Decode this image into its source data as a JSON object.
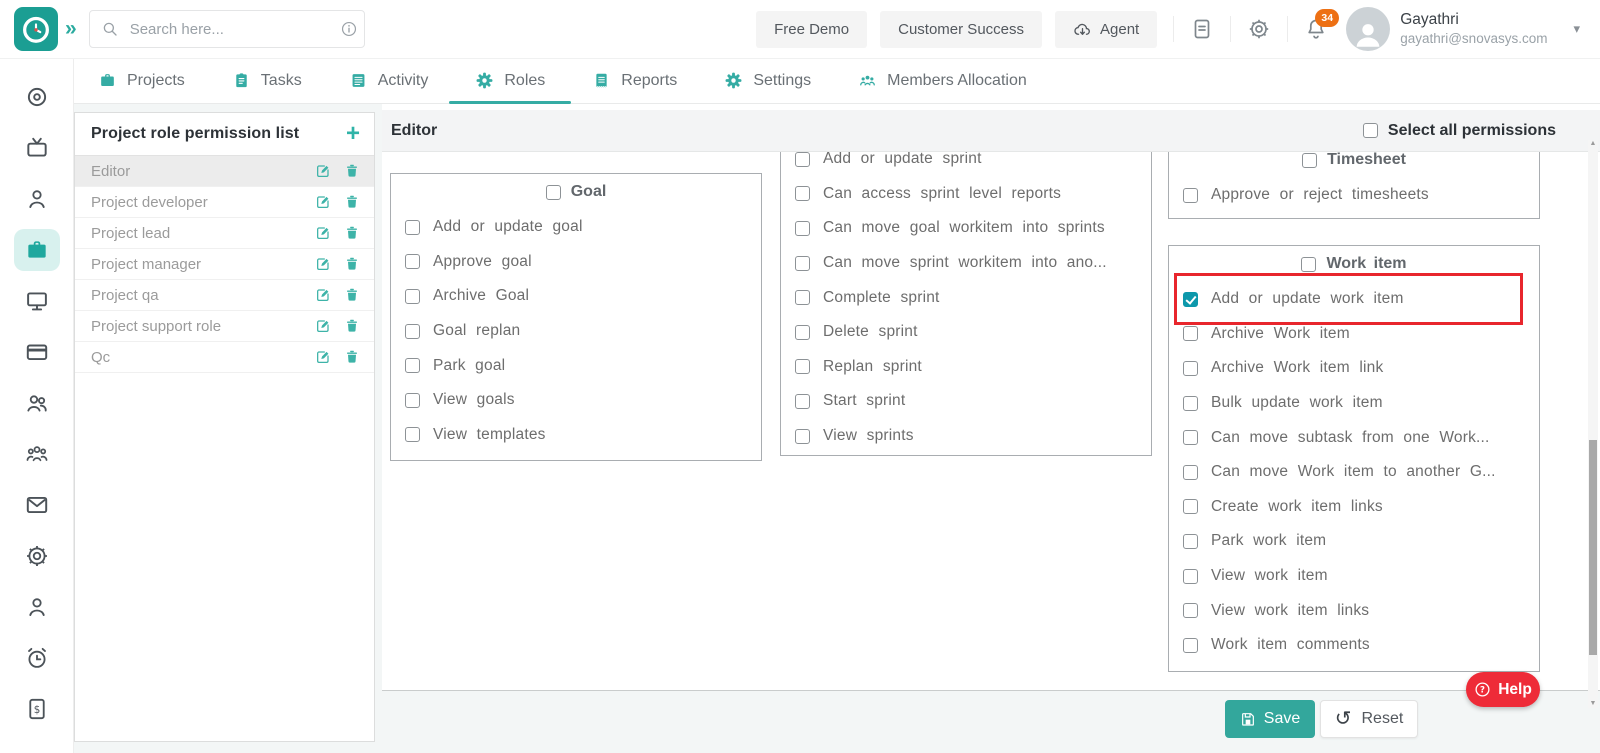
{
  "topbar": {
    "search_placeholder": "Search here...",
    "free_demo_label": "Free Demo",
    "customer_success_label": "Customer Success",
    "agent_label": "Agent",
    "notification_count": "34",
    "user_name": "Gayathri",
    "user_email": "gayathri@snovasys.com"
  },
  "tabs": [
    {
      "label": "Projects",
      "icon": "briefcase-icon",
      "active": false
    },
    {
      "label": "Tasks",
      "icon": "clipboard-icon",
      "active": false
    },
    {
      "label": "Activity",
      "icon": "activity-list-icon",
      "active": false
    },
    {
      "label": "Roles",
      "icon": "roles-gear-icon",
      "active": true
    },
    {
      "label": "Reports",
      "icon": "report-icon",
      "active": false
    },
    {
      "label": "Settings",
      "icon": "settings-gear-icon",
      "active": false
    },
    {
      "label": "Members Allocation",
      "icon": "members-group-icon",
      "active": false
    }
  ],
  "sidebar": {
    "active_index": 3,
    "icons": [
      "target-icon",
      "tv-icon",
      "person-icon",
      "briefcase-icon",
      "monitor-icon",
      "credit-card-icon",
      "users-pair-icon",
      "team-icon",
      "mail-icon",
      "gear-icon",
      "person-outline-icon",
      "alarm-clock-icon",
      "invoice-icon"
    ]
  },
  "role_panel": {
    "title": "Project role permission list",
    "add_label": "+",
    "roles": [
      {
        "label": "Editor",
        "selected": true
      },
      {
        "label": "Project developer",
        "selected": false
      },
      {
        "label": "Project lead",
        "selected": false
      },
      {
        "label": "Project manager",
        "selected": false
      },
      {
        "label": "Project qa",
        "selected": false
      },
      {
        "label": "Project support role",
        "selected": false
      },
      {
        "label": "Qc",
        "selected": false
      }
    ]
  },
  "permissions_header": {
    "role_title": "Editor",
    "select_all_label": "Select all permissions",
    "select_all_checked": false
  },
  "permission_groups": [
    {
      "id": "goal",
      "title": "Goal",
      "title_visible": true,
      "group_checked": false,
      "items": [
        {
          "label": "Add or update goal",
          "checked": false
        },
        {
          "label": "Approve goal",
          "checked": false
        },
        {
          "label": "Archive Goal",
          "checked": false
        },
        {
          "label": "Goal replan",
          "checked": false
        },
        {
          "label": "Park goal",
          "checked": false
        },
        {
          "label": "View goals",
          "checked": false
        },
        {
          "label": "View templates",
          "checked": false
        }
      ]
    },
    {
      "id": "sprint",
      "title": "",
      "title_visible": false,
      "items": [
        {
          "label": "Add or update sprint",
          "checked": false
        },
        {
          "label": "Can access sprint level reports",
          "checked": false
        },
        {
          "label": "Can move goal workitem into sprints",
          "checked": false
        },
        {
          "label": "Can move sprint workitem into ano...",
          "checked": false
        },
        {
          "label": "Complete sprint",
          "checked": false
        },
        {
          "label": "Delete sprint",
          "checked": false
        },
        {
          "label": "Replan sprint",
          "checked": false
        },
        {
          "label": "Start sprint",
          "checked": false
        },
        {
          "label": "View sprints",
          "checked": false
        }
      ]
    },
    {
      "id": "timesheet",
      "title": "Timesheet",
      "title_visible": true,
      "group_checked": false,
      "items": [
        {
          "label": "Approve or reject timesheets",
          "checked": false
        }
      ]
    },
    {
      "id": "workitem",
      "title": "Work item",
      "title_visible": true,
      "group_checked": false,
      "items": [
        {
          "label": "Add or update work item",
          "checked": true,
          "highlighted": true
        },
        {
          "label": "Archive Work item",
          "checked": false
        },
        {
          "label": "Archive Work item link",
          "checked": false
        },
        {
          "label": "Bulk update work item",
          "checked": false
        },
        {
          "label": "Can move subtask from one Work...",
          "checked": false
        },
        {
          "label": "Can move Work item to another G...",
          "checked": false
        },
        {
          "label": "Create work item links",
          "checked": false
        },
        {
          "label": "Park work item",
          "checked": false
        },
        {
          "label": "View work item",
          "checked": false
        },
        {
          "label": "View work item links",
          "checked": false
        },
        {
          "label": "Work item comments",
          "checked": false
        }
      ]
    }
  ],
  "footer": {
    "save_label": "Save",
    "reset_label": "Reset",
    "help_label": "Help"
  },
  "colors": {
    "accent_teal": "#1FA39A",
    "checked_checkbox": "#0D98AB",
    "highlight_red": "#E8262D",
    "help_red": "#EE2B38",
    "badge_orange": "#ED7014",
    "active_rail_bg": "#D8F1EE"
  }
}
